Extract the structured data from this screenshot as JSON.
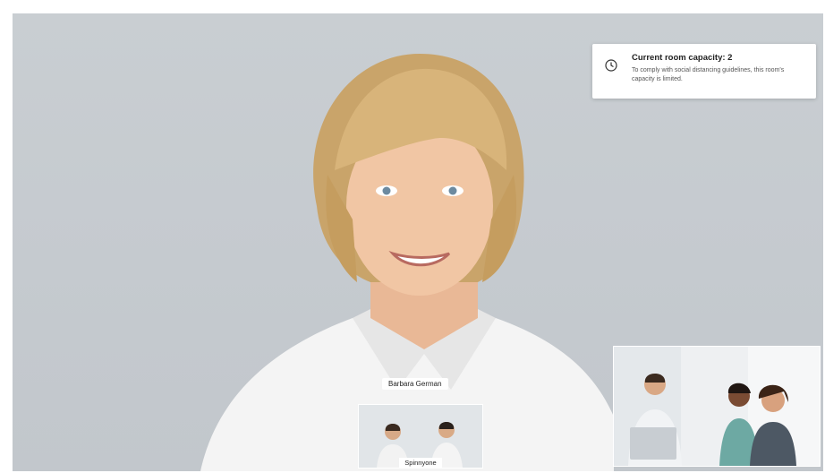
{
  "notification": {
    "icon": "clock-icon",
    "title": "Current room capacity: 2",
    "body": "To comply with social distancing guidelines, this room's capacity is limited."
  },
  "main_speaker": {
    "name": "Barbara German"
  },
  "participants": [
    {
      "label": "Spinnyone"
    },
    {
      "label": ""
    }
  ],
  "colors": {
    "background": "#c7ccd0",
    "toast_bg": "#ffffff"
  }
}
